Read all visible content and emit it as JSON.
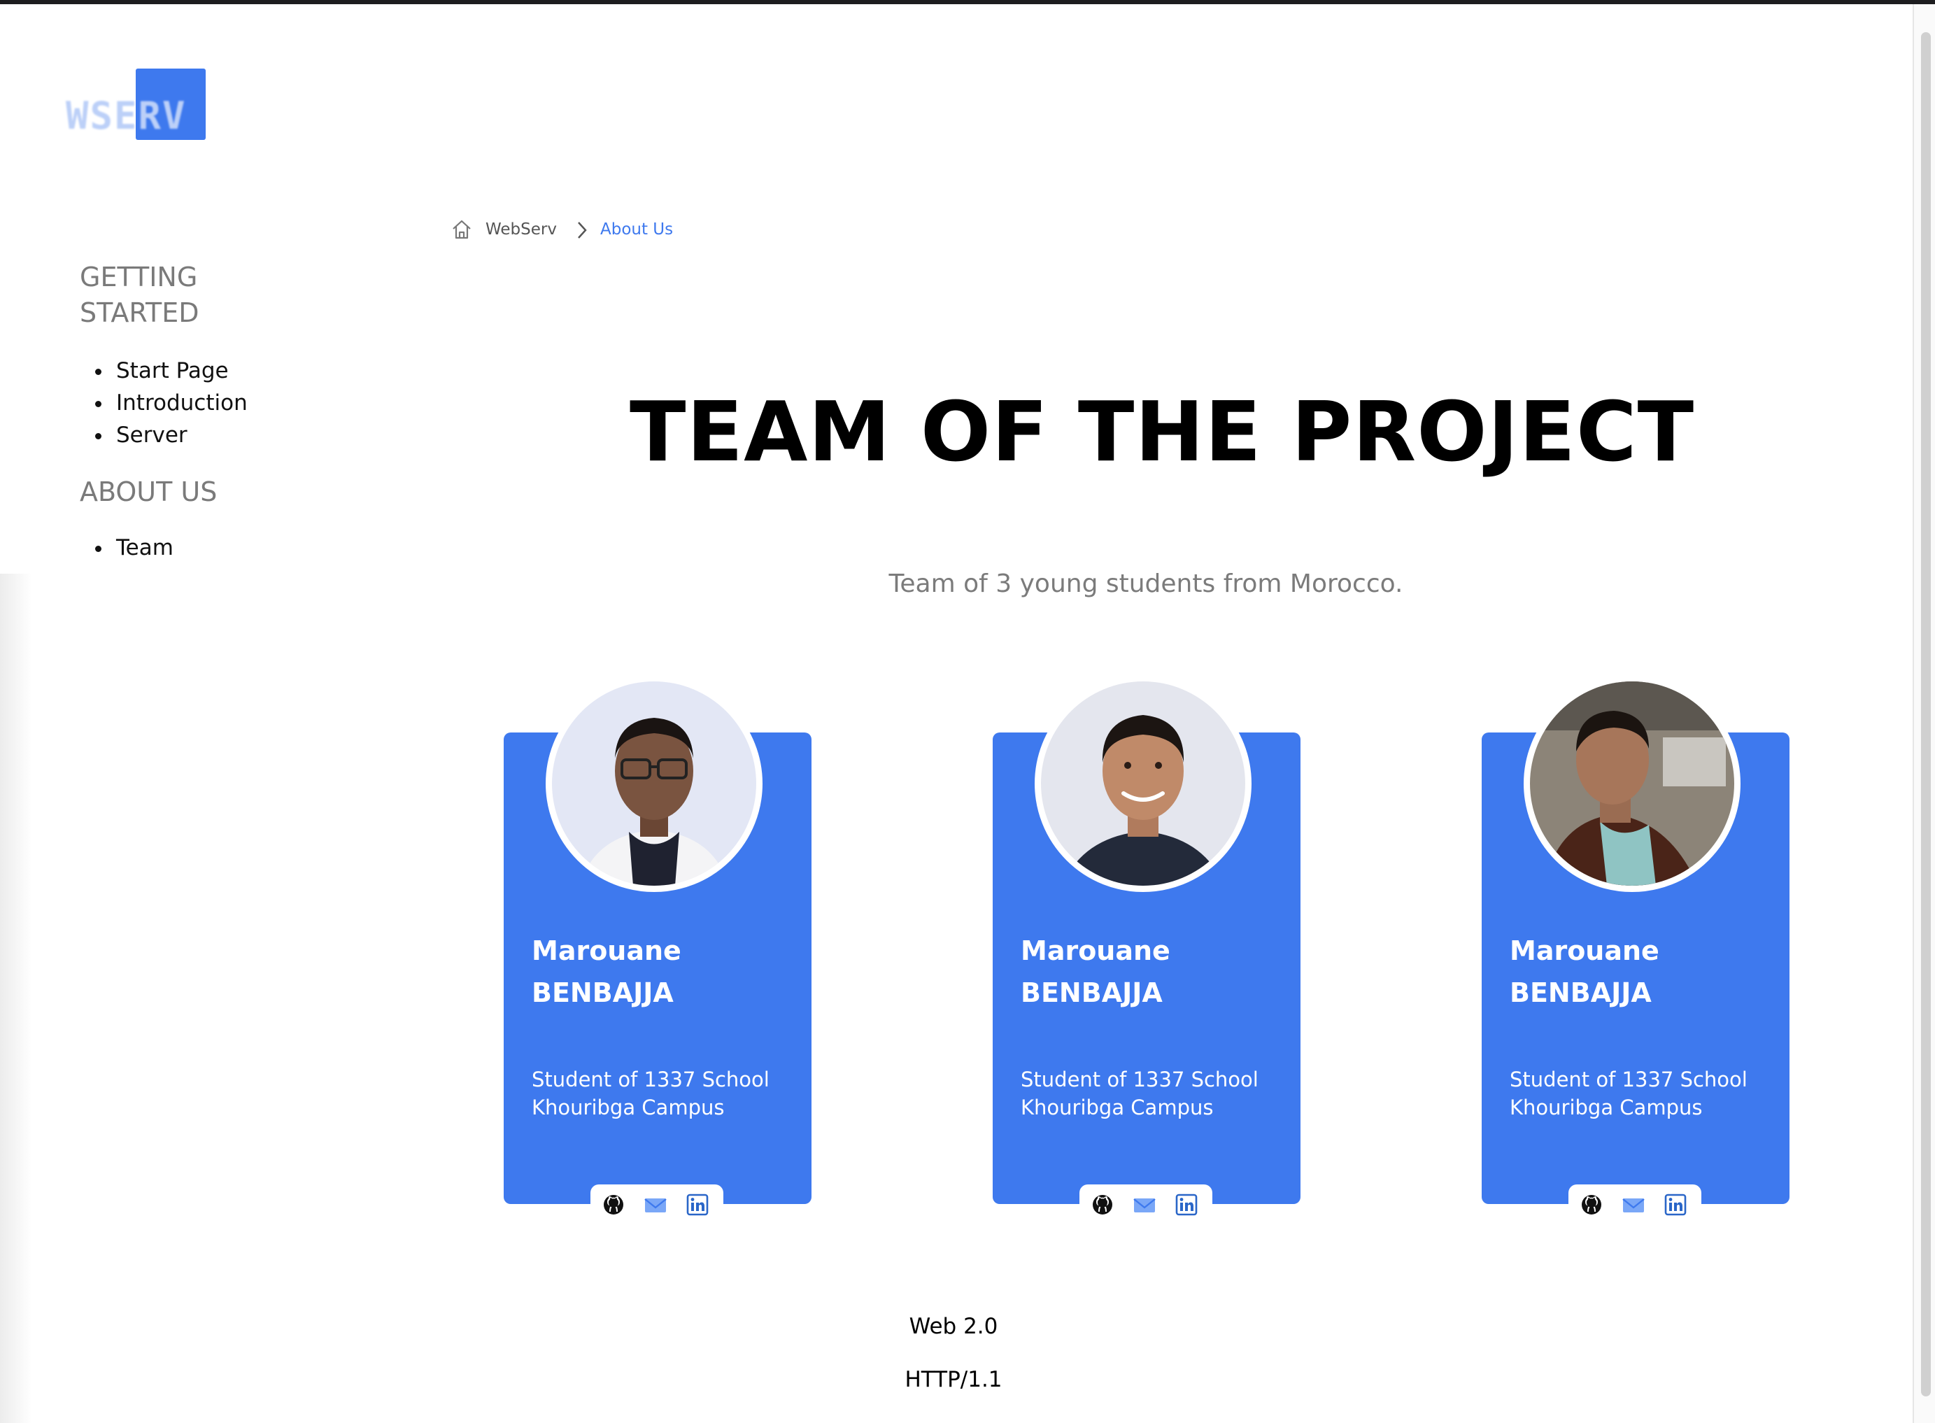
{
  "logo": {
    "text": "WSERV"
  },
  "sidebar": {
    "sections": [
      {
        "heading": "GETTING STARTED",
        "items": [
          "Start Page",
          "Introduction",
          "Server"
        ]
      },
      {
        "heading": "ABOUT US",
        "items": [
          "Team"
        ]
      }
    ]
  },
  "breadcrumb": {
    "home_label": "WebServ",
    "current": "About Us"
  },
  "main": {
    "title": "TEAM OF THE PROJECT",
    "subtitle": "Team of 3 young students from Morocco."
  },
  "members": [
    {
      "first_name": "Marouane",
      "last_name": "BENBAJJA",
      "role_line1": "Student of 1337 School",
      "role_line2": "Khouribga Campus"
    },
    {
      "first_name": "Marouane",
      "last_name": "BENBAJJA",
      "role_line1": "Student of 1337 School",
      "role_line2": "Khouribga Campus"
    },
    {
      "first_name": "Marouane",
      "last_name": "BENBAJJA",
      "role_line1": "Student of 1337 School",
      "role_line2": "Khouribga Campus"
    }
  ],
  "social_icons": [
    "github-icon",
    "mail-icon",
    "linkedin-icon"
  ],
  "footer": {
    "line1": "Web 2.0",
    "line2": "HTTP/1.1"
  },
  "colors": {
    "accent": "#3e79ee",
    "text": "#111111",
    "muted": "#7b7b7b"
  }
}
